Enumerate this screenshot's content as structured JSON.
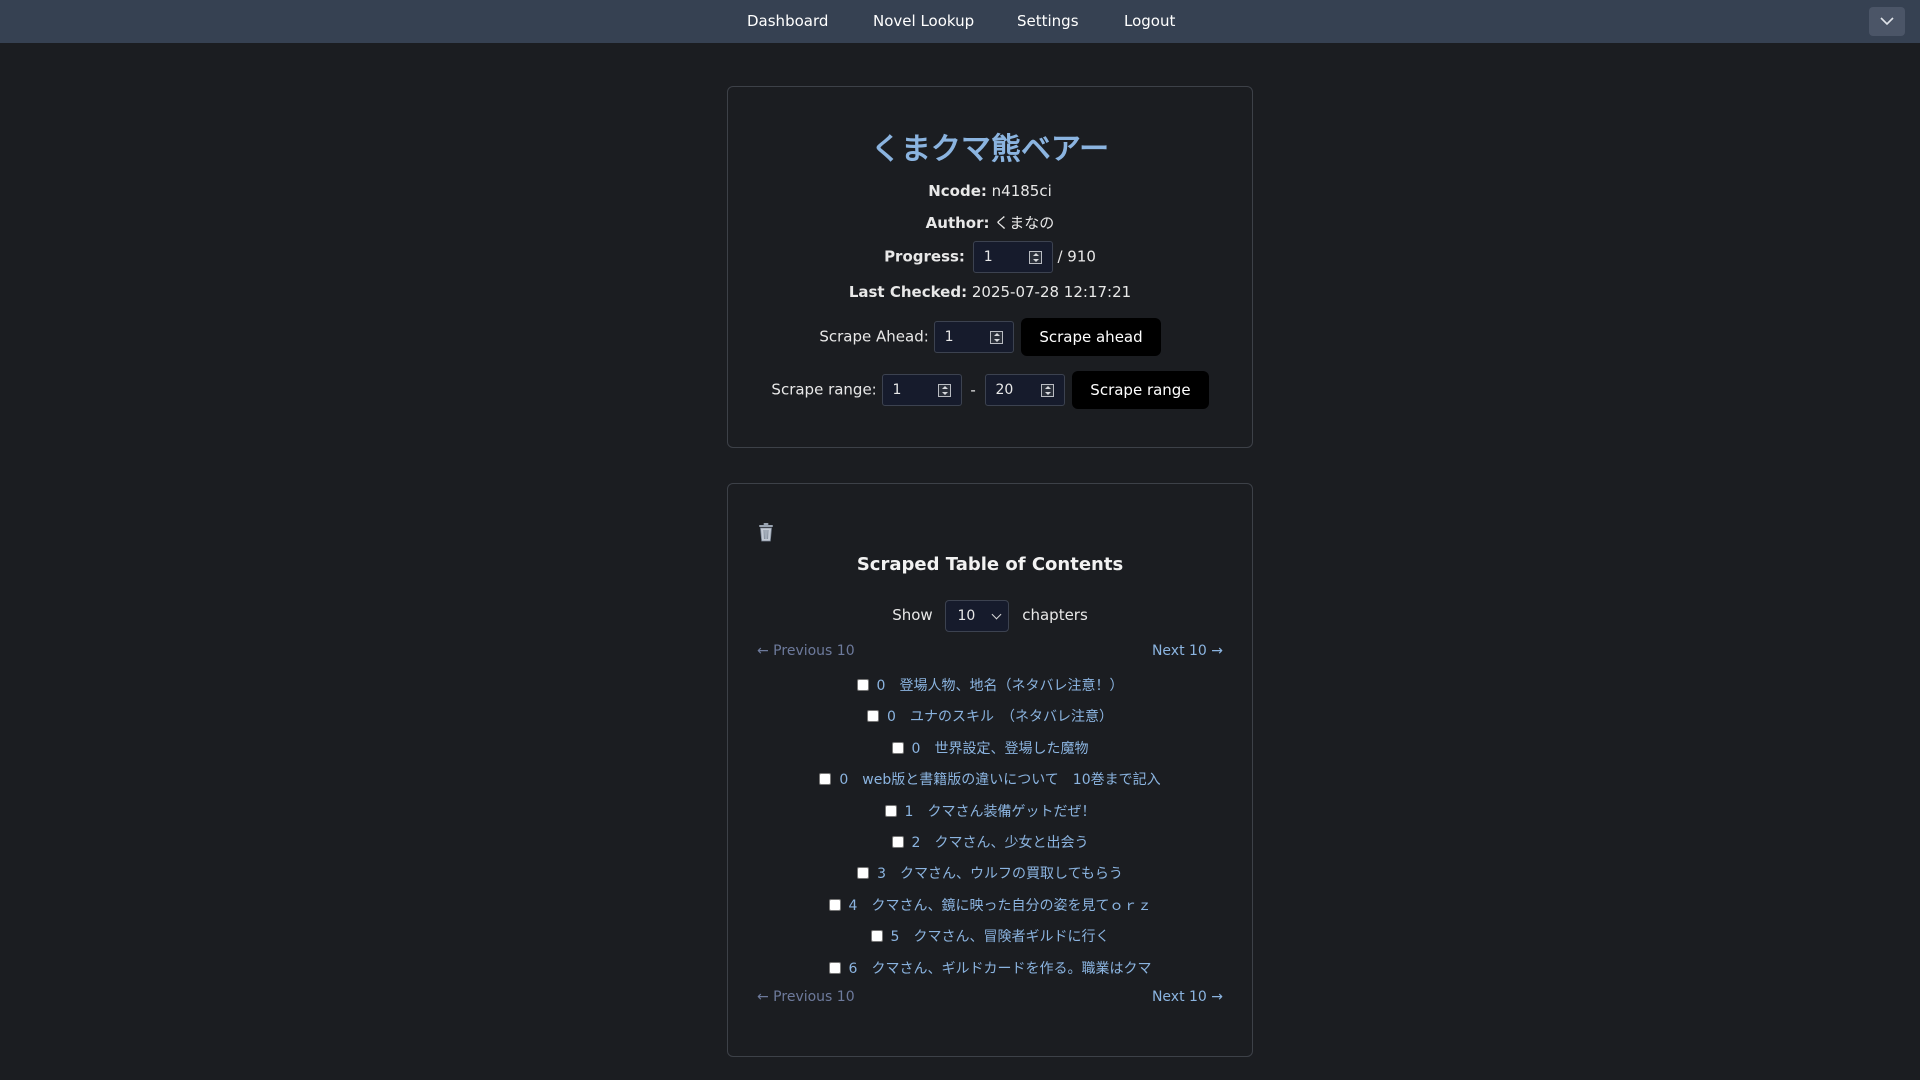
{
  "nav": {
    "items": [
      "Dashboard",
      "Novel Lookup",
      "Settings",
      "Logout"
    ]
  },
  "novel": {
    "title": "くまクマ熊ベアー",
    "ncode_label": "Ncode:",
    "ncode": "n4185ci",
    "author_label": "Author:",
    "author": "くまなの",
    "progress_label": "Progress:",
    "progress_value": "1",
    "progress_total": "/ 910",
    "last_checked_label": "Last Checked:",
    "last_checked": "2025-07-28 12:17:21",
    "scrape_ahead_label": "Scrape Ahead:",
    "scrape_ahead_value": "1",
    "scrape_ahead_button": "Scrape ahead",
    "scrape_range_label": "Scrape range:",
    "range_from": "1",
    "range_sep": "-",
    "range_to": "20",
    "scrape_range_button": "Scrape range"
  },
  "toc": {
    "title": "Scraped Table of Contents",
    "show_label": "Show",
    "show_value": "10",
    "chapters_label": "chapters",
    "prev_label": "← Previous 10",
    "next_label": "Next 10 →",
    "chapters": [
      {
        "num": "0",
        "title": "登場人物、地名（ネタバレ注意！）"
      },
      {
        "num": "0",
        "title": "ユナのスキル　（ネタバレ注意）"
      },
      {
        "num": "0",
        "title": "世界設定、登場した魔物"
      },
      {
        "num": "0",
        "title": "web版と書籍版の違いについて　10巻まで記入"
      },
      {
        "num": "1",
        "title": "クマさん装備ゲットだぜ！"
      },
      {
        "num": "2",
        "title": "クマさん、少女と出会う"
      },
      {
        "num": "3",
        "title": "クマさん、ウルフの買取してもらう"
      },
      {
        "num": "4",
        "title": "クマさん、鏡に映った自分の姿を見てｏｒｚ"
      },
      {
        "num": "5",
        "title": "クマさん、冒険者ギルドに行く"
      },
      {
        "num": "6",
        "title": "クマさん、ギルドカードを作る。職業はクマ"
      }
    ]
  },
  "icons": {
    "trash": "trash-icon",
    "menu": "chevron-down-icon"
  }
}
